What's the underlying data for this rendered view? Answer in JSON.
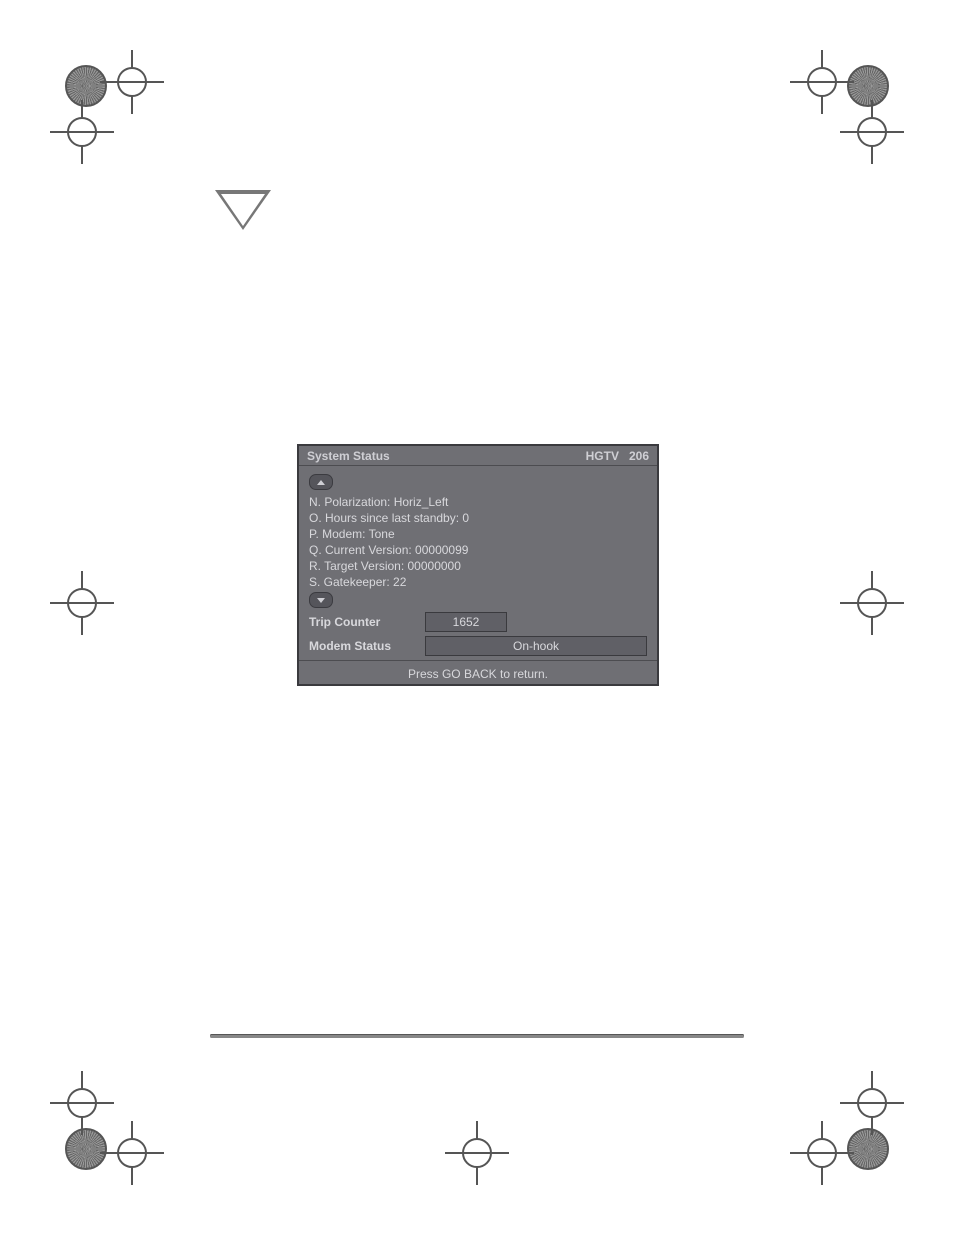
{
  "panel": {
    "title": "System Status",
    "channel_name": "HGTV",
    "channel_number": "206",
    "lines": [
      "N.  Polarization:  Horiz_Left",
      "O.  Hours since last standby:  0",
      "P.  Modem:  Tone",
      "Q.  Current Version:  00000099",
      "R.  Target Version:  00000000",
      "S.  Gatekeeper:  22"
    ],
    "trip_counter_label": "Trip Counter",
    "trip_counter_value": "1652",
    "modem_status_label": "Modem Status",
    "modem_status_value": "On-hook",
    "footer": "Press GO BACK to return."
  }
}
